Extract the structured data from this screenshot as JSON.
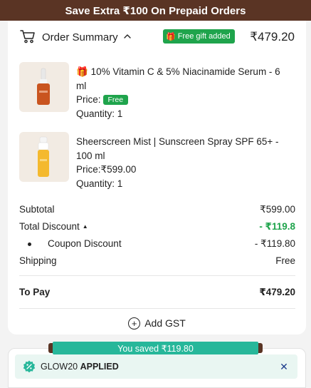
{
  "banner": {
    "text": "Save Extra ₹100 On Prepaid Orders"
  },
  "summary": {
    "title": "Order Summary",
    "gift_badge": "Free gift added",
    "total": "₹479.20"
  },
  "items": [
    {
      "gift_icon": "🎁",
      "name": "10% Vitamin C & 5% Niacinamide Serum - 6 ml",
      "price_label": "Price:",
      "price": "Free",
      "quantity": "Quantity: 1",
      "thumb_icon": "dropper-bottle-icon"
    },
    {
      "name": "Sheerscreen Mist | Sunscreen Spray SPF 65+ - 100 ml",
      "price_label": "Price:",
      "price": "₹599.00",
      "quantity": "Quantity: 1",
      "thumb_icon": "spray-bottle-icon"
    }
  ],
  "bill": {
    "subtotal_label": "Subtotal",
    "subtotal": "₹599.00",
    "discount_label": "Total Discount",
    "discount": "- ₹119.8",
    "coupon_label": "Coupon Discount",
    "coupon": "- ₹119.80",
    "shipping_label": "Shipping",
    "shipping": "Free",
    "topay_label": "To Pay",
    "topay": "₹479.20"
  },
  "gst": {
    "label": "Add GST"
  },
  "savings": {
    "text": "You saved ₹119.80"
  },
  "coupon": {
    "code": "GLOW20",
    "status": "APPLIED",
    "close": "✕"
  },
  "colors": {
    "banner": "#5a3424",
    "green": "#1fa44c",
    "teal": "#27b79a",
    "coupon_bg": "#e9f6f2",
    "close": "#1d3c8c"
  }
}
